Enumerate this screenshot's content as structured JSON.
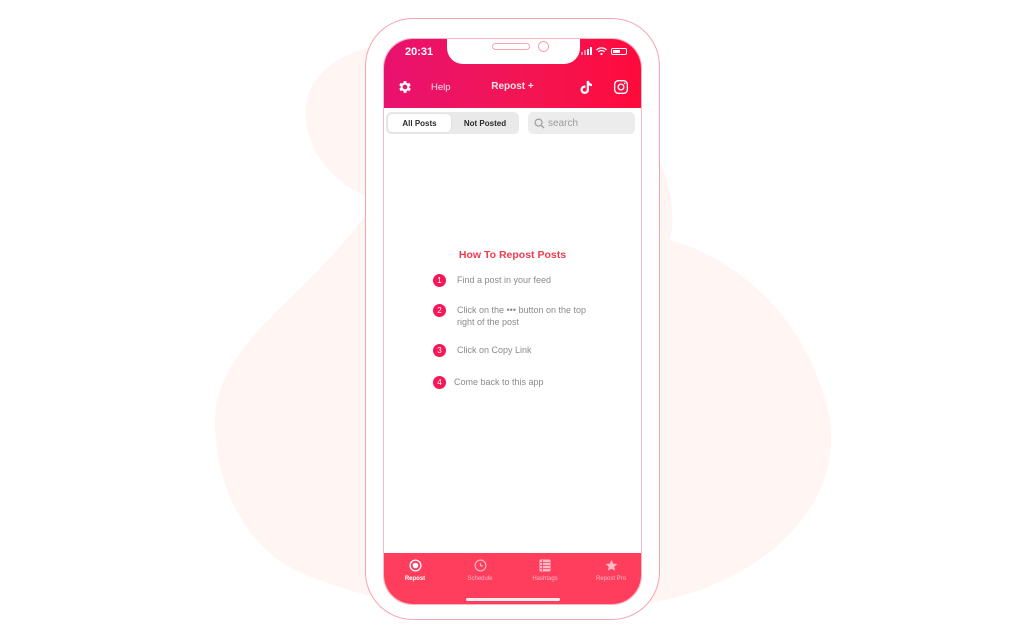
{
  "colors": {
    "header_gradient_start": "#e8126f",
    "header_gradient_end": "#ff0a3c",
    "accent": "#f51757",
    "heading": "#ee3b4e",
    "tabbar": "#ff3e5d",
    "frame": "#f7a3b1",
    "background_blob": "#fff5f3"
  },
  "status_bar": {
    "time": "20:31",
    "icons": [
      "signal-icon",
      "wifi-icon",
      "battery-icon"
    ]
  },
  "header": {
    "settings_icon": "gear-icon",
    "help_label": "Help",
    "title": "Repost +",
    "tiktok_icon": "tiktok-icon",
    "instagram_icon": "instagram-icon"
  },
  "filter": {
    "segments": [
      {
        "label": "All Posts",
        "selected": true
      },
      {
        "label": "Not Posted",
        "selected": false
      }
    ],
    "search": {
      "value": "",
      "placeholder": "search",
      "icon": "search-icon"
    }
  },
  "instructions": {
    "title": "How To Repost Posts",
    "steps": [
      {
        "number": "1",
        "text": "Find a post in your feed"
      },
      {
        "number": "2",
        "text": "Click on the ••• button on the top right of the post"
      },
      {
        "number": "3",
        "text": "Click on Copy Link"
      },
      {
        "number": "4",
        "text": "Come back to this app"
      }
    ]
  },
  "tabbar": {
    "tabs": [
      {
        "label": "Repost",
        "icon": "radio-target-icon",
        "active": true
      },
      {
        "label": "Schedule",
        "icon": "clock-icon",
        "active": false
      },
      {
        "label": "Hashtags",
        "icon": "list-grid-icon",
        "active": false
      },
      {
        "label": "Repost Pro",
        "icon": "star-icon",
        "active": false
      }
    ]
  }
}
